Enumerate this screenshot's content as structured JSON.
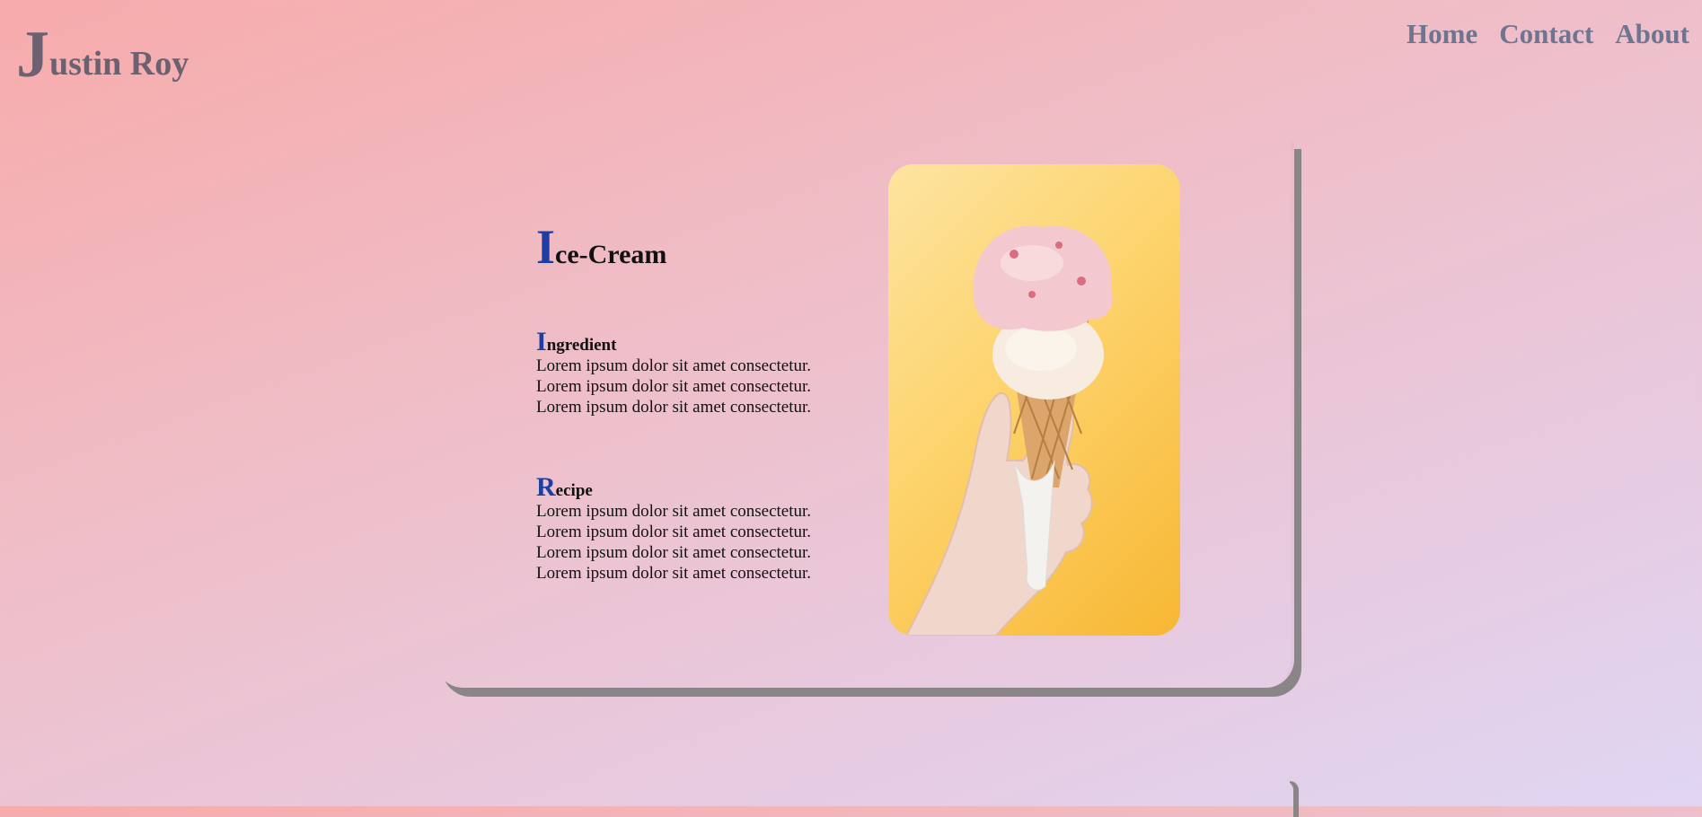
{
  "logo": {
    "initial": "J",
    "rest": "ustin Roy"
  },
  "nav": {
    "items": [
      "Home",
      "Contact",
      "About"
    ]
  },
  "card": {
    "title_initial": "I",
    "title_rest": "ce-Cream",
    "ingredient": {
      "heading_initial": "I",
      "heading_rest": "ngredient",
      "lines": [
        "Lorem ipsum dolor sit amet consectetur.",
        "Lorem ipsum dolor sit amet consectetur.",
        "Lorem ipsum dolor sit amet consectetur."
      ]
    },
    "recipe": {
      "heading_initial": "R",
      "heading_rest": "ecipe",
      "lines": [
        "Lorem ipsum dolor sit amet consectetur.",
        "Lorem ipsum dolor sit amet consectetur.",
        "Lorem ipsum dolor sit amet consectetur.",
        "Lorem ipsum dolor sit amet consectetur."
      ]
    },
    "image_icon": "ice-cream-cone-photo"
  },
  "colors": {
    "accent": "#1d3fa3",
    "logo": "#6b6171",
    "nav": "#6f7591",
    "shadow": "#8a8687"
  }
}
